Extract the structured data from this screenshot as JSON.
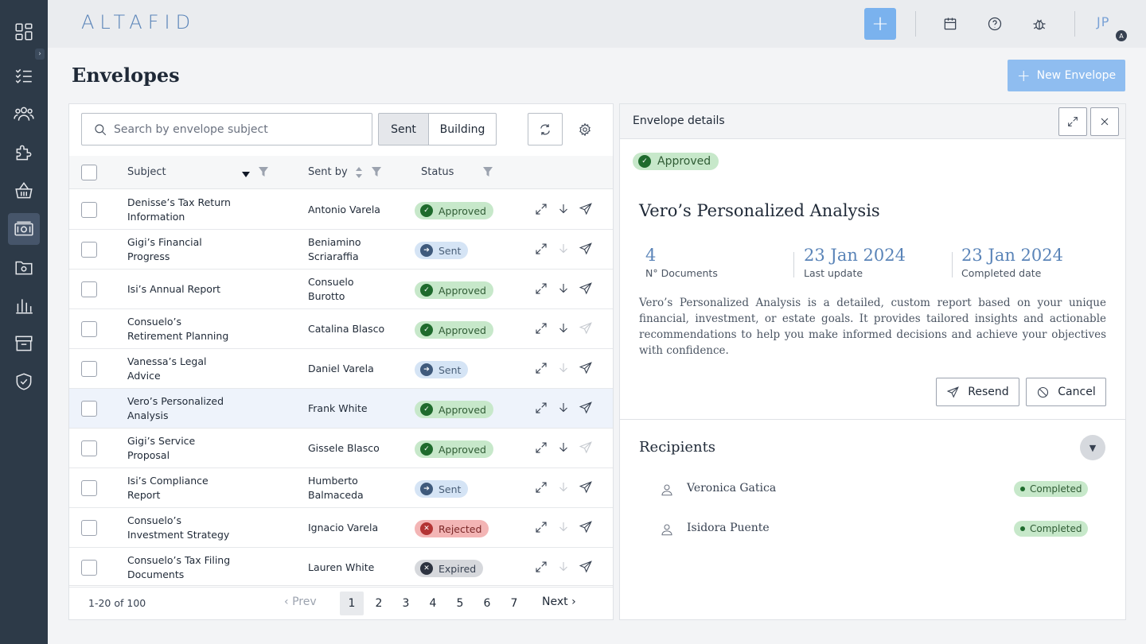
{
  "app": {
    "logo": "ALTAFID",
    "user_initials": "JP",
    "user_badge": "A"
  },
  "sidebar": {
    "items": [
      "dashboard-icon",
      "tasks-icon",
      "users-icon",
      "integrations-icon",
      "basket-icon",
      "envelopes-icon",
      "folder-settings-icon",
      "reports-icon",
      "archive-icon",
      "security-icon"
    ],
    "active": "envelopes-icon"
  },
  "page": {
    "title": "Envelopes",
    "new_button": "New Envelope"
  },
  "toolbar": {
    "search_placeholder": "Search by envelope subject",
    "tab_sent": "Sent",
    "tab_building": "Building"
  },
  "table": {
    "headers": {
      "subject": "Subject",
      "sent_by": "Sent by",
      "status": "Status"
    },
    "rows": [
      {
        "subject": "Denisse’s Tax Return Information",
        "sent_by": "Antonio Varela",
        "status": "Approved",
        "download_enabled": true,
        "send_enabled": true
      },
      {
        "subject": "Gigi’s Financial Progress",
        "sent_by": "Beniamino Scriaraffia",
        "status": "Sent",
        "download_enabled": false,
        "send_enabled": true
      },
      {
        "subject": "Isi’s Annual Report",
        "sent_by": "Consuelo Burotto",
        "status": "Approved",
        "download_enabled": true,
        "send_enabled": true
      },
      {
        "subject": "Consuelo’s Retirement Planning",
        "sent_by": "Catalina Blasco",
        "status": "Approved",
        "download_enabled": true,
        "send_enabled": false
      },
      {
        "subject": "Vanessa’s Legal Advice",
        "sent_by": "Daniel Varela",
        "status": "Sent",
        "download_enabled": false,
        "send_enabled": true
      },
      {
        "subject": "Vero’s Personalized Analysis",
        "sent_by": "Frank White",
        "status": "Approved",
        "download_enabled": true,
        "send_enabled": true,
        "selected": true
      },
      {
        "subject": "Gigi’s Service Proposal",
        "sent_by": "Gissele Blasco",
        "status": "Approved",
        "download_enabled": true,
        "send_enabled": false
      },
      {
        "subject": "Isi’s Compliance Report",
        "sent_by": "Humberto Balmaceda",
        "status": "Sent",
        "download_enabled": false,
        "send_enabled": true
      },
      {
        "subject": "Consuelo’s Investment Strategy",
        "sent_by": "Ignacio Varela",
        "status": "Rejected",
        "download_enabled": false,
        "send_enabled": true
      },
      {
        "subject": "Consuelo’s Tax Filing Documents",
        "sent_by": "Lauren White",
        "status": "Expired",
        "download_enabled": false,
        "send_enabled": true
      }
    ]
  },
  "pagination": {
    "info": "1-20 of 100",
    "prev": "Prev",
    "next": "Next",
    "pages": [
      "1",
      "2",
      "3",
      "4",
      "5",
      "6",
      "7"
    ],
    "current": "1"
  },
  "details": {
    "header": "Envelope details",
    "status": "Approved",
    "name": "Vero’s Personalized Analysis",
    "stats": [
      {
        "value": "4",
        "label": "N° Documents"
      },
      {
        "value": "23 Jan 2024",
        "label": "Last update"
      },
      {
        "value": "23 Jan 2024",
        "label": "Completed date"
      }
    ],
    "description": "Vero’s Personalized Analysis is a detailed, custom report based on your unique financial, investment, or estate goals. It provides tailored insights and actionable recommendations to help you make informed decisions and achieve your objectives with confidence.",
    "resend": "Resend",
    "cancel": "Cancel",
    "recipients_title": "Recipients",
    "recipients": [
      {
        "name": "Veronica Gatica",
        "status": "Completed"
      },
      {
        "name": "Isidora Puente",
        "status": "Completed"
      }
    ]
  },
  "colors": {
    "sidebar": "#2d3a48",
    "accent": "#7ab2ee",
    "brand_text": "#5a84b8",
    "approved": "#c7e8ca",
    "sent": "#d5e4f5",
    "rejected": "#f3b5b5",
    "expired": "#d6d8dc"
  }
}
